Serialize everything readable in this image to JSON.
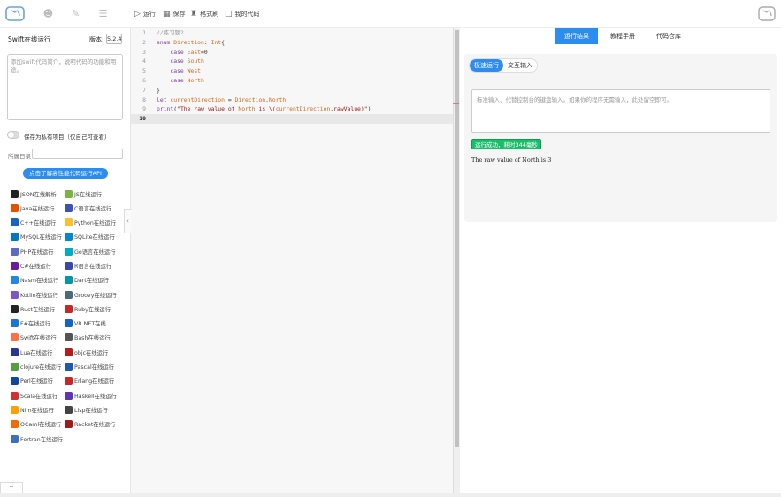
{
  "toolbar": {
    "run_label": "运行",
    "save_label": "保存",
    "format_label": "格式刷",
    "mycode_label": "我的代码"
  },
  "left": {
    "title": "Swift在线运行",
    "version_label": "版本:",
    "version_value": "5.2.4",
    "desc_placeholder": "添加swift代码简介，说明代码的功能和用途。",
    "private_label": "保存为私有项目（仅自己可查看）",
    "dir_label": "所属目录",
    "api_button": "点击了解高性能代码运行API",
    "languages": [
      [
        "JSON在线解析",
        "JS在线运行"
      ],
      [
        "Java在线运行",
        "C语言在线运行"
      ],
      [
        "C++在线运行",
        "Python在线运行"
      ],
      [
        "MySQL在线运行",
        "SQLite在线运行"
      ],
      [
        "PHP在线运行",
        "Go语言在线运行"
      ],
      [
        "C#在线运行",
        "R语言在线运行"
      ],
      [
        "Nasm在线运行",
        "Dart在线运行"
      ],
      [
        "Kotlin在线运行",
        "Groovy在线运行"
      ],
      [
        "Rust在线运行",
        "Ruby在线运行"
      ],
      [
        "F#在线运行",
        "VB.NET在线"
      ],
      [
        "Swift在线运行",
        "Bash在线运行"
      ],
      [
        "Lua在线运行",
        "objc在线运行"
      ],
      [
        "clojure在线运行",
        "Pascal在线运行"
      ],
      [
        "Perl在线运行",
        "Erlang在线运行"
      ],
      [
        "Scala在线运行",
        "Haskell在线运行"
      ],
      [
        "Nim在线运行",
        "Lisp在线运行"
      ],
      [
        "OCaml在线运行",
        "Racket在线运行"
      ],
      [
        "Fortran在线运行",
        ""
      ]
    ],
    "lang_colors": [
      [
        "#222",
        "#7cb342"
      ],
      [
        "#e65100",
        "#3f51b5"
      ],
      [
        "#1565c0",
        "#fbc02d"
      ],
      [
        "#0277bd",
        "#0288d1"
      ],
      [
        "#5c6bc0",
        "#00acc1"
      ],
      [
        "#6a1b9a",
        "#3949ab"
      ],
      [
        "#1e88e5",
        "#0097a7"
      ],
      [
        "#7e57c2",
        "#4a6a7a"
      ],
      [
        "#222",
        "#c62828"
      ],
      [
        "#1976d2",
        "#1565c0"
      ],
      [
        "#ff7043",
        "#555"
      ],
      [
        "#283593",
        "#b71c1c"
      ],
      [
        "#5a9d3f",
        "#1e5aa8"
      ],
      [
        "#0d47a1",
        "#c62828"
      ],
      [
        "#d32f2f",
        "#5e35b1"
      ],
      [
        "#ffa000",
        "#444"
      ],
      [
        "#ef6c00",
        "#9e1b1b"
      ],
      [
        "#3b73b9",
        ""
      ]
    ]
  },
  "editor": {
    "lines": [
      {
        "n": "1",
        "t": "//练习题2"
      },
      {
        "n": "2",
        "t": "enum Direction: Int{"
      },
      {
        "n": "3",
        "t": "    case East=0"
      },
      {
        "n": "4",
        "t": "    case South"
      },
      {
        "n": "5",
        "t": "    case West"
      },
      {
        "n": "6",
        "t": "    case North"
      },
      {
        "n": "7",
        "t": "}"
      },
      {
        "n": "8",
        "t": "let currentDirection = Direction.North"
      },
      {
        "n": "9",
        "t": "print(\"The raw value of North is \\(currentDirection.rawValue)\")"
      },
      {
        "n": "10",
        "t": ""
      }
    ]
  },
  "right": {
    "tabs": [
      "运行结果",
      "教程手册",
      "代码仓库"
    ],
    "subtabs": [
      "极速运行",
      "交互输入"
    ],
    "stdin_placeholder": "标准输入、代替控制台的键盘输入。如果你的程序无需输入，此处留空即可。",
    "status": "运行成功，耗时344毫秒",
    "output": "The raw value of North is 3"
  }
}
